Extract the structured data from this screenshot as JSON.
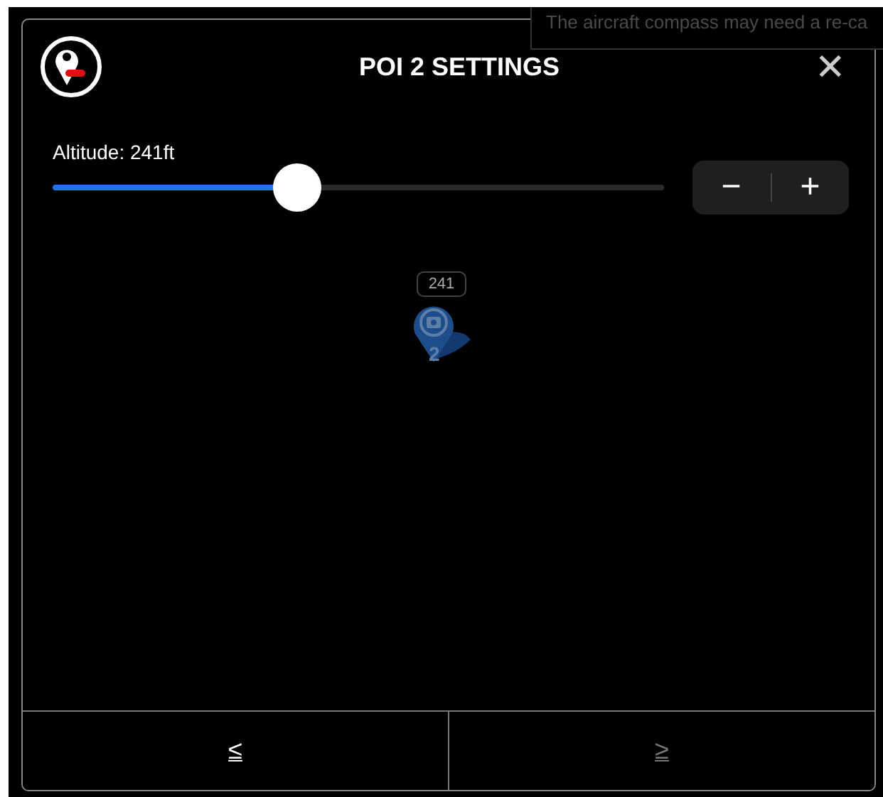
{
  "toast": {
    "text": "The aircraft compass may need a re-ca"
  },
  "dialog": {
    "title": "POI 2 SETTINGS",
    "close": "✕"
  },
  "altitude": {
    "label": "Altitude: 241ft",
    "level": 0.4,
    "decrement": "−",
    "increment": "+"
  },
  "marker": {
    "altitude": "241",
    "number": "2"
  },
  "navigation": [
    {
      "label": "≤",
      "disabled": false
    },
    {
      "label": "≥",
      "disabled": true
    }
  ]
}
